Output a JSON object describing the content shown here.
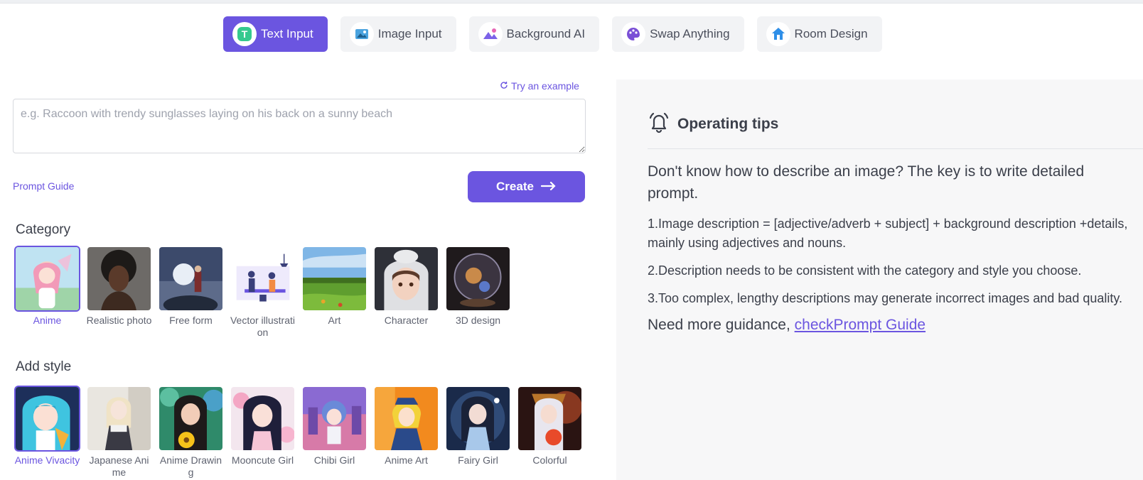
{
  "tabs": [
    {
      "label": "Text Input",
      "icon": "text-input-icon",
      "active": true
    },
    {
      "label": "Image Input",
      "icon": "image-input-icon",
      "active": false
    },
    {
      "label": "Background AI",
      "icon": "background-ai-icon",
      "active": false
    },
    {
      "label": "Swap Anything",
      "icon": "swap-anything-icon",
      "active": false
    },
    {
      "label": "Room Design",
      "icon": "room-design-icon",
      "active": false
    }
  ],
  "prompt": {
    "try_example": "Try an example",
    "placeholder": "e.g. Raccoon with trendy sunglasses laying on his back on a sunny beach",
    "guide_link": "Prompt Guide",
    "create_label": "Create"
  },
  "category": {
    "title": "Category",
    "items": [
      {
        "label": "Anime",
        "selected": true
      },
      {
        "label": "Realistic photo",
        "selected": false
      },
      {
        "label": "Free form",
        "selected": false
      },
      {
        "label": "Vector illustration",
        "selected": false
      },
      {
        "label": "Art",
        "selected": false
      },
      {
        "label": "Character",
        "selected": false
      },
      {
        "label": "3D design",
        "selected": false
      }
    ]
  },
  "style": {
    "title": "Add style",
    "items": [
      {
        "label": "Anime Vivacity",
        "selected": true
      },
      {
        "label": "Japanese Anime",
        "selected": false
      },
      {
        "label": "Anime Drawing",
        "selected": false
      },
      {
        "label": "Mooncute Girl",
        "selected": false
      },
      {
        "label": "Chibi Girl",
        "selected": false
      },
      {
        "label": "Anime Art",
        "selected": false
      },
      {
        "label": "Fairy Girl",
        "selected": false
      },
      {
        "label": "Colorful",
        "selected": false
      }
    ]
  },
  "tips": {
    "title": "Operating tips",
    "intro": "Don't know how to describe an image? The key is to write detailed prompt.",
    "items": [
      "1.Image description = [adjective/adverb + subject] + background description +details, mainly using adjectives and nouns.",
      "2.Description needs to be consistent with the category and style you choose.",
      "3.Too complex, lengthy descriptions may generate incorrect images and bad quality."
    ],
    "more_prefix": "Need more guidance, ",
    "more_link": "checkPrompt Guide"
  },
  "colors": {
    "accent": "#6b55e0",
    "panel": "#f7f7f8"
  }
}
